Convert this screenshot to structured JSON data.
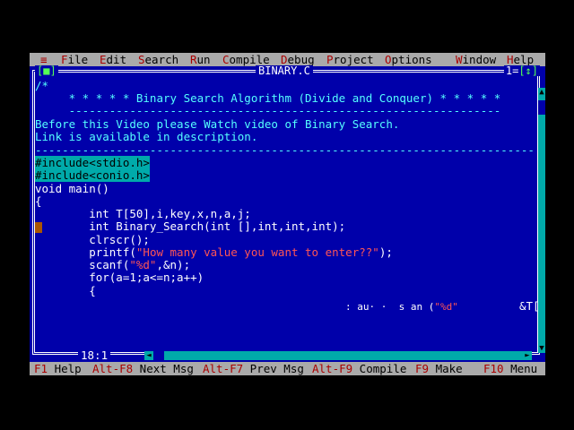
{
  "menu": {
    "system": "≡",
    "items": [
      {
        "hot": "F",
        "rest": "ile"
      },
      {
        "hot": "E",
        "rest": "dit"
      },
      {
        "hot": "S",
        "rest": "earch"
      },
      {
        "hot": "R",
        "rest": "un"
      },
      {
        "hot": "C",
        "rest": "ompile"
      },
      {
        "hot": "D",
        "rest": "ebug"
      },
      {
        "hot": "P",
        "rest": "roject"
      },
      {
        "hot": "O",
        "rest": "ptions"
      },
      {
        "hot": "W",
        "rest": "indow"
      },
      {
        "hot": "H",
        "rest": "elp"
      }
    ]
  },
  "window": {
    "title": "BINARY.C",
    "close_box": "[■]",
    "number": "1",
    "zoom_box": "[↕]"
  },
  "code": {
    "l1": "/*",
    "l2": "     * * * * * Binary Search Algorithm (Divide and Conquer) * * * * *",
    "l3": "     ----------------------------------------------------------------",
    "l4": "Before this Video please Watch video of Binary Search.",
    "l5": "Link is available in description.",
    "l6": "--------------------------------------------------------------------------",
    "l7": "#include<stdio.h>",
    "l8": "#include<conio.h>",
    "l9": "void main()",
    "l10": "{",
    "l11": "        int T[50],i,key,x,n,a,j;",
    "l12": "        int Binary_Search(int [],int,int,int);",
    "l13": "        clrscr();",
    "l14a": "        printf(",
    "l14b": "\"How many value you want to enter??\"",
    "l14c": ");",
    "l15a": "        scanf(",
    "l15b": "\"%d\"",
    "l15c": ",&n);",
    "l16": "        for(a=1;a<=n;a++)",
    "l17": "        {",
    "l18a": ": au· ·  s an (",
    "l18b": "\"%d\"",
    "l18c": "&T["
  },
  "status": {
    "position": "18:1"
  },
  "footer": [
    {
      "key": "F1",
      "label": " Help"
    },
    {
      "key": "Alt-F8",
      "label": " Next Msg"
    },
    {
      "key": "Alt-F7",
      "label": " Prev Msg"
    },
    {
      "key": "Alt-F9",
      "label": " Compile"
    },
    {
      "key": "F9",
      "label": " Make"
    },
    {
      "key": "F10",
      "label": " Menu"
    }
  ],
  "colors": {
    "editor_bg": "#0000aa",
    "menu_bg": "#aaaaaa",
    "hotkey": "#aa0000",
    "comment": "#55ffff",
    "string": "#ff5555",
    "include_bg": "#00aaaa"
  }
}
